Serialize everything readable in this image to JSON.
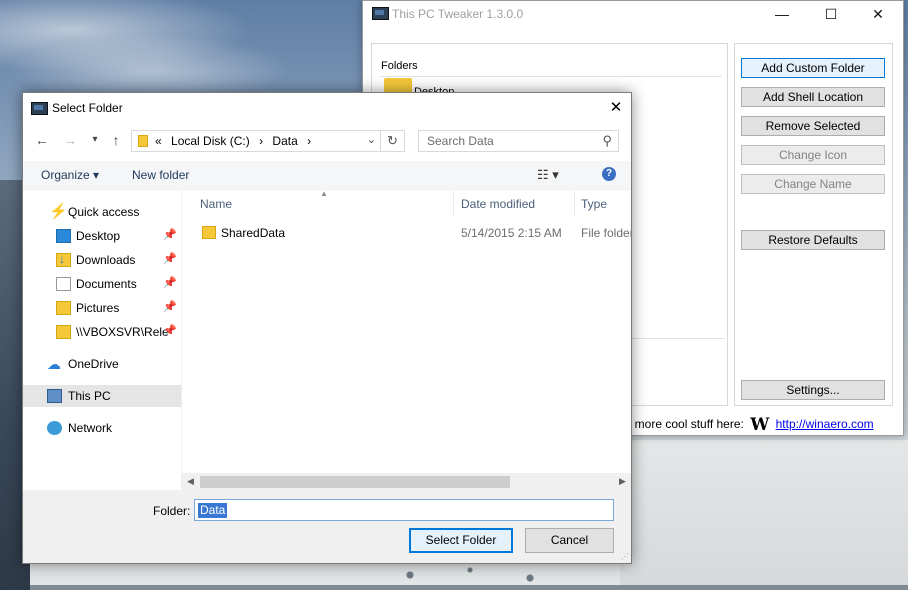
{
  "tweaker": {
    "title": "This PC Tweaker 1.3.0.0",
    "controls": {
      "minimize": "—",
      "maximize": "☐",
      "close": "✕"
    },
    "folders_label": "Folders",
    "first_item": "Desktop",
    "buttons": {
      "add_custom_folder": "Add Custom Folder",
      "add_shell_location": "Add Shell Location",
      "remove_selected": "Remove Selected",
      "change_icon": "Change Icon",
      "change_name": "Change Name",
      "restore_defaults": "Restore Defaults",
      "settings": "Settings..."
    },
    "footer_text": "t more cool stuff here:",
    "footer_logo": "W",
    "footer_link": "http://winaero.com"
  },
  "dialog": {
    "title": "Select Folder",
    "close": "✕",
    "nav": {
      "back": "←",
      "forward": "→",
      "recent": "▾",
      "up": "↑"
    },
    "address": {
      "prefix": "«",
      "crumbs": [
        "Local Disk (C:)",
        "›",
        "Data",
        "›"
      ],
      "dropdown": "⌄",
      "refresh": "↻"
    },
    "search": {
      "placeholder": "Search Data",
      "icon": "⚲"
    },
    "commands": {
      "organize": "Organize ▾",
      "new_folder": "New folder",
      "view": "☷ ▾",
      "help": "?"
    },
    "nav_pane": [
      {
        "label": "Quick access",
        "icon": "star-icon",
        "pinned": false
      },
      {
        "label": "Desktop",
        "icon": "desktop-icon",
        "pinned": true
      },
      {
        "label": "Downloads",
        "icon": "downloads-icon",
        "pinned": true
      },
      {
        "label": "Documents",
        "icon": "documents-icon",
        "pinned": true
      },
      {
        "label": "Pictures",
        "icon": "pictures-icon",
        "pinned": true
      },
      {
        "label": "\\\\VBOXSVR\\Rele",
        "icon": "network-folder-icon",
        "pinned": true
      },
      {
        "label": "OneDrive",
        "icon": "onedrive-icon",
        "pinned": false
      },
      {
        "label": "This PC",
        "icon": "this-pc-icon",
        "pinned": false,
        "selected": true
      },
      {
        "label": "Network",
        "icon": "network-icon",
        "pinned": false
      }
    ],
    "pin_glyph": "📌",
    "columns": {
      "name": "Name",
      "date_modified": "Date modified",
      "type": "Type"
    },
    "files": [
      {
        "name": "SharedData",
        "date_modified": "5/14/2015 2:15 AM",
        "type": "File folder"
      }
    ],
    "scroll": {
      "left": "◀",
      "right": "▶"
    },
    "folder_label": "Folder:",
    "folder_value": "Data",
    "buttons": {
      "select": "Select Folder",
      "cancel": "Cancel"
    }
  },
  "colors": {
    "accent": "#0078d7",
    "selection": "#3a77d2",
    "folder": "#f5c83a"
  }
}
